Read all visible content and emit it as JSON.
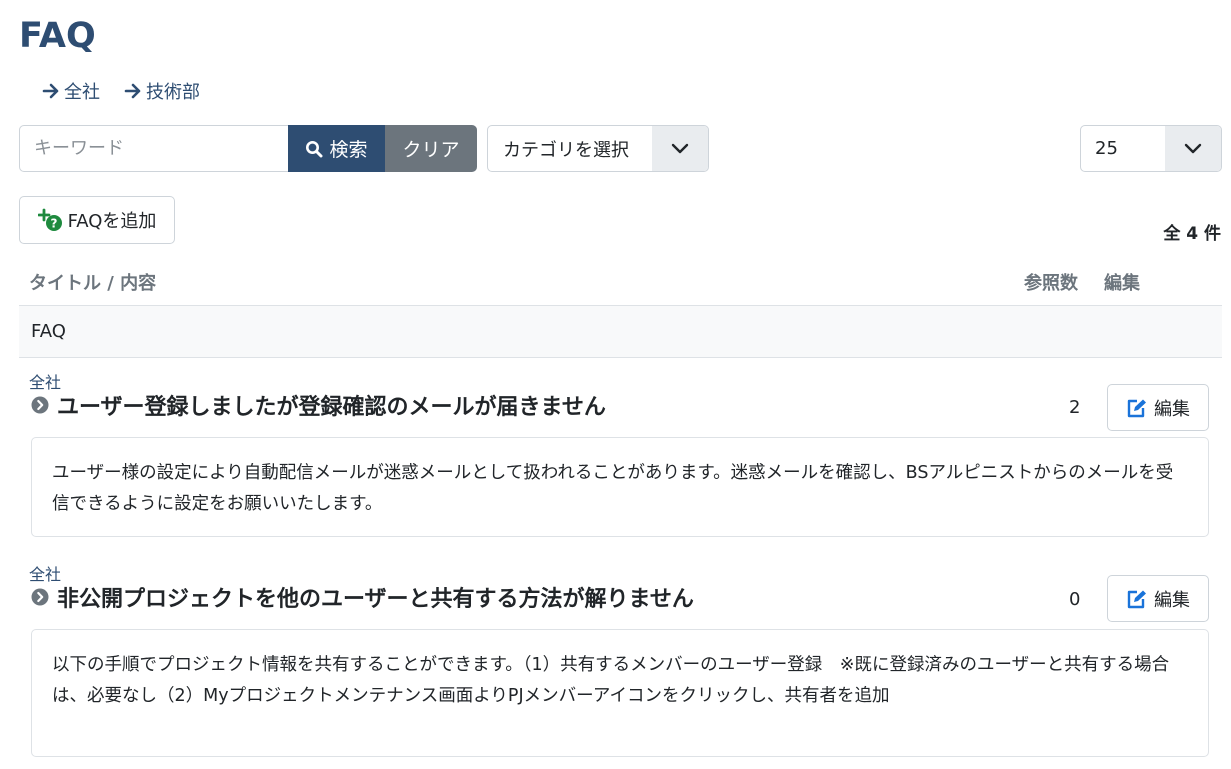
{
  "page": {
    "title": "FAQ"
  },
  "breadcrumbs": [
    {
      "label": "全社"
    },
    {
      "label": "技術部"
    }
  ],
  "search": {
    "placeholder": "キーワード",
    "search_label": "検索",
    "clear_label": "クリア"
  },
  "category_select": {
    "value": "カテゴリを選択"
  },
  "per_page_select": {
    "value": "25"
  },
  "add_button": {
    "label": "FAQを追加"
  },
  "total_label": "全 4 件",
  "table": {
    "headers": {
      "title": "タイトル / 内容",
      "views": "参照数",
      "edit": "編集"
    },
    "group": "FAQ",
    "items": [
      {
        "category": "全社",
        "title": "ユーザー登録しましたが登録確認のメールが届きません",
        "views": "2",
        "edit_label": "編集",
        "body": "ユーザー様の設定により自動配信メールが迷惑メールとして扱われることがあります。迷惑メールを確認し、BSアルピニストからのメールを受信できるように設定をお願いいたします。"
      },
      {
        "category": "全社",
        "title": "非公開プロジェクトを他のユーザーと共有する方法が解りません",
        "views": "0",
        "edit_label": "編集",
        "body": "以下の手順でプロジェクト情報を共有することができます。（1）共有するメンバーのユーザー登録　※既に登録済みのユーザーと共有する場合は、必要なし（2）Myプロジェクトメンテナンス画面よりPJメンバーアイコンをクリックし、共有者を追加"
      }
    ]
  },
  "colors": {
    "brand": "#2e4d72",
    "secondary": "#6c757d",
    "add_icon": "#1e8a3e",
    "edit_icon": "#1a73d9"
  },
  "icons": {
    "breadcrumb": "arrow-right-icon",
    "search": "search-icon",
    "dropdown": "chevron-down-icon",
    "add": "plus-question-icon",
    "faq_title": "chevron-circle-right-icon",
    "edit": "edit-square-icon"
  }
}
